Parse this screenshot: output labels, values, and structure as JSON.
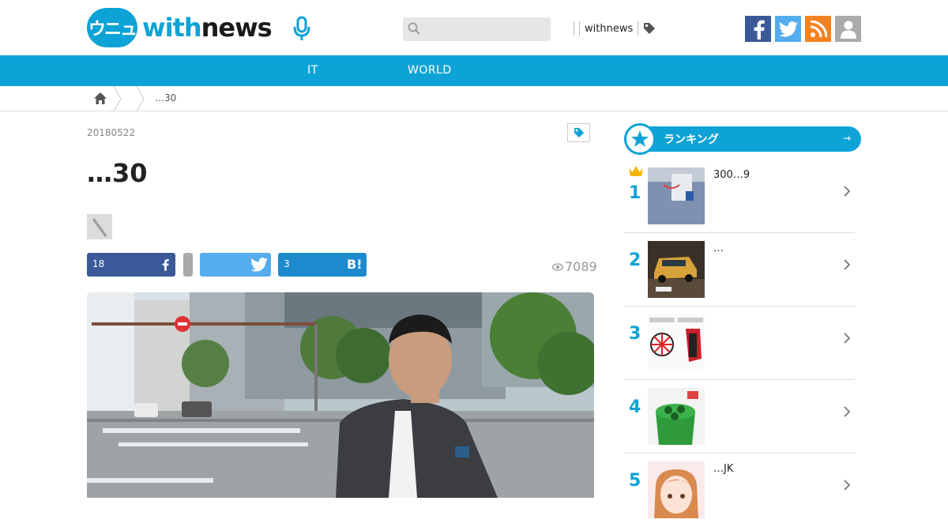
{
  "header": {
    "logo_mark": "ウニュ",
    "logo_with": "with",
    "logo_news": "news",
    "search_placeholder": "",
    "link_withnews": "withnews"
  },
  "nav": {
    "items": [
      {
        "label": "IT"
      },
      {
        "label": "WORLD"
      }
    ]
  },
  "breadcrumb": {
    "current": "…30"
  },
  "article": {
    "date": "20180522",
    "title": "…30",
    "share": {
      "facebook_count": "18",
      "hatena_count": "3",
      "hatena_label": "B!"
    },
    "views": "7089"
  },
  "ranking": {
    "title": "ランキング",
    "arrow": "→",
    "items": [
      {
        "rank": "1",
        "text": "300…9"
      },
      {
        "rank": "2",
        "text": "…"
      },
      {
        "rank": "3",
        "text": ""
      },
      {
        "rank": "4",
        "text": ""
      },
      {
        "rank": "5",
        "text": "…JK"
      }
    ]
  },
  "colors": {
    "brand": "#0ea3d6",
    "facebook": "#3b5998",
    "twitter": "#55acee",
    "rss": "#f58220",
    "hatena": "#1d8acd"
  }
}
